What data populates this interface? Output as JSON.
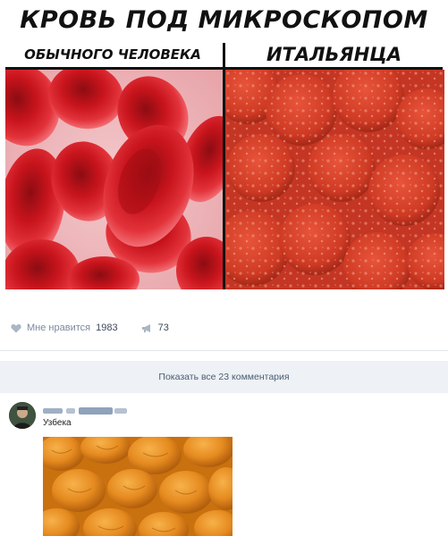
{
  "meme": {
    "title": "КРОВЬ ПОД МИКРОСКОПОМ",
    "left_header": "ОБЫЧНОГО ЧЕЛОВЕКА",
    "right_header": "ИТАЛЬЯНЦА"
  },
  "post_actions": {
    "like_label": "Мне нравится",
    "like_count": "1983",
    "share_count": "73"
  },
  "comments": {
    "show_all_label": "Показать все 23 комментария",
    "items": [
      {
        "text": "Узбека"
      }
    ]
  },
  "colors": {
    "blood_red": "#c8141c",
    "pepperoni": "#d9432b",
    "apricot": "#e58a1f",
    "link_blue": "#4a5d75"
  }
}
